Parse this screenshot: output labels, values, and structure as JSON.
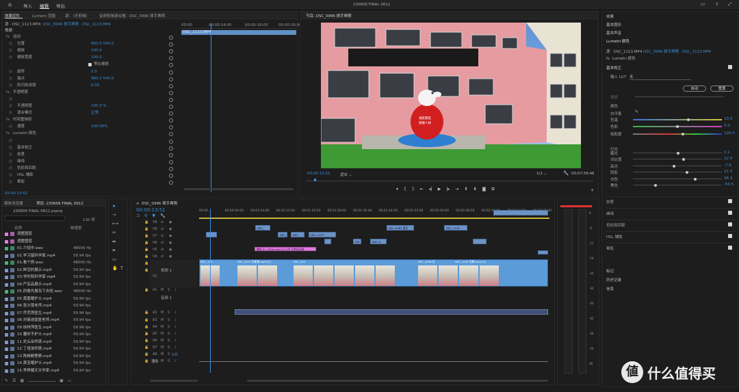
{
  "topbar": {
    "nav": [
      "导入",
      "编辑",
      "导出"
    ],
    "title": "230606 FINAL 0612"
  },
  "source_panel": {
    "tabs": [
      "效果控件",
      "Lumetri 范围",
      "源：（无剪辑）",
      "音频剪辑混合器：DSC_0996 择手典照"
    ],
    "source_label": "源 · DSC_1113.MP4",
    "seq_label": "DSC_0996 择手典照 · DSC_1113.MP4",
    "video_header": "视频",
    "ruler": [
      "00:00",
      "00:00:14:00",
      "00:00:16:00",
      "00:00:18:00"
    ],
    "clip_label": "DSC_1113.MP4",
    "rows": [
      {
        "name": "运动",
        "val": "",
        "indent": 1
      },
      {
        "name": "位置",
        "val": "960.0    540.0",
        "indent": 2
      },
      {
        "name": "缩放",
        "val": "100.0",
        "indent": 2
      },
      {
        "name": "缩放宽度",
        "val": "100.0",
        "indent": 2
      },
      {
        "name": "",
        "val": "等比缩放",
        "indent": 3
      },
      {
        "name": "旋转",
        "val": "0.0",
        "indent": 2
      },
      {
        "name": "锚点",
        "val": "960.0    540.0",
        "indent": 2
      },
      {
        "name": "防闪烁滤镜",
        "val": "0.00",
        "indent": 2
      },
      {
        "name": "不透明度",
        "val": "",
        "indent": 1
      },
      {
        "name": "",
        "val": "",
        "indent": 2
      },
      {
        "name": "不透明度",
        "val": "100.0 %",
        "indent": 2
      },
      {
        "name": "混合模式",
        "val": "正常",
        "indent": 2
      },
      {
        "name": "时间重映射",
        "val": "",
        "indent": 1
      },
      {
        "name": "速度",
        "val": "100.00%",
        "indent": 2
      },
      {
        "name": "Lumetri 颜色",
        "val": "",
        "indent": 1
      },
      {
        "name": "",
        "val": "",
        "indent": 2
      },
      {
        "name": "基本校正",
        "val": "",
        "indent": 2
      },
      {
        "name": "创意",
        "val": "",
        "indent": 2
      },
      {
        "name": "曲线",
        "val": "",
        "indent": 2
      },
      {
        "name": "色轮和匹配",
        "val": "",
        "indent": 2
      },
      {
        "name": "HSL 辅助",
        "val": "",
        "indent": 2
      },
      {
        "name": "晕影",
        "val": "",
        "indent": 2
      }
    ],
    "timecode": "00:00:13:51"
  },
  "program": {
    "tab": "节目: DSC_0996 择手典照",
    "timecode": "00:00:13:51",
    "fit": "适合",
    "quality": "1/2",
    "duration": "00:07:59:46",
    "sign_text": [
      "满庭都是",
      "健康人格"
    ]
  },
  "lumetri": {
    "menu": [
      "效果",
      "基本图形",
      "基本声音",
      "Lumetri 颜色"
    ],
    "source": "源 · DSC_1113.MP4",
    "seq": "DSC_0996 择手典照 · DSC_1113.MP4",
    "fx_label": "Lumetri 颜色",
    "basic": "基本校正",
    "lut_label": "输入 LUT",
    "lut_val": "无",
    "auto": "自动",
    "reset": "重置",
    "intensity": "强度",
    "color_head": "颜色",
    "wb": "白平衡",
    "light_head": "灯光",
    "sliders": [
      {
        "name": "色温",
        "val": "10.0",
        "pos": 0.62
      },
      {
        "name": "色彩",
        "val": "0.0",
        "pos": 0.5
      },
      {
        "name": "饱和度",
        "val": "120.0",
        "pos": 0.56
      },
      {
        "name": "曝光",
        "val": "0.1",
        "pos": 0.51
      },
      {
        "name": "对比度",
        "val": "12.9",
        "pos": 0.57
      },
      {
        "name": "高光",
        "val": "-7.6",
        "pos": 0.46
      },
      {
        "name": "阴影",
        "val": "21.3",
        "pos": 0.61
      },
      {
        "name": "白色",
        "val": "38.3",
        "pos": 0.7
      },
      {
        "name": "黑色",
        "val": "-50.5",
        "pos": 0.25
      }
    ],
    "sections": [
      "创意",
      "曲线",
      "色轮和匹配",
      "HSL 辅助",
      "晕影"
    ],
    "bottom": [
      "标记",
      "历史记录",
      "信息"
    ]
  },
  "project": {
    "tabs": [
      "媒体浏览器",
      "项目: 230606 FINAL 0612"
    ],
    "file": "230606 FINAL 0612.prproj",
    "count": "130 项",
    "col_name": "名称",
    "col_rate": "帧速率",
    "items": [
      {
        "name": "调整图层",
        "rate": "",
        "c": "#e27ce0"
      },
      {
        "name": "调整图层",
        "rate": "",
        "c": "#e27ce0"
      },
      {
        "name": "01.介绍中.wav",
        "rate": "48000 Hz",
        "c": "#48b47e"
      },
      {
        "name": "01.学习猛科学家.mp4",
        "rate": "59.94 fps",
        "c": "#7e96c7"
      },
      {
        "name": "01.看个例.wav",
        "rate": "48000 Hz",
        "c": "#48b47e"
      },
      {
        "name": "02.鲜活的展示.mp4",
        "rate": "59.94 fps",
        "c": "#7e96c7"
      },
      {
        "name": "03.学的阳科学家.mp4",
        "rate": "59.94 fps",
        "c": "#7e96c7"
      },
      {
        "name": "04.严芸品展示.mp4",
        "rate": "59.94 fps",
        "c": "#7e96c7"
      },
      {
        "name": "05.同看先展及下去啦.wav",
        "rate": "48000 Hz",
        "c": "#48b47e"
      },
      {
        "name": "05.黄嘉耀护士.mp4",
        "rate": "59.94 fps",
        "c": "#7e96c7"
      },
      {
        "name": "06.张沙蓬老师.mp4",
        "rate": "59.94 fps",
        "c": "#7e96c7"
      },
      {
        "name": "07.乔范莲医生.mp4",
        "rate": "59.94 fps",
        "c": "#7e96c7"
      },
      {
        "name": "08.刘曼迪兽医老师.mp4",
        "rate": "59.94 fps",
        "c": "#7e96c7"
      },
      {
        "name": "09.徐林萍医生.mp4",
        "rate": "59.94 fps",
        "c": "#7e96c7"
      },
      {
        "name": "10.蕃昕予护士.mp4",
        "rate": "59.94 fps",
        "c": "#7e96c7"
      },
      {
        "name": "11.史云朵师席.mp4",
        "rate": "59.94 fps",
        "c": "#7e96c7"
      },
      {
        "name": "12.丁增淑师席.mp4",
        "rate": "59.94 fps",
        "c": "#7e96c7"
      },
      {
        "name": "13.陈嫣殿警察.mp4",
        "rate": "59.94 fps",
        "c": "#7e96c7"
      },
      {
        "name": "14.黄宝喔护士.mp4",
        "rate": "59.94 fps",
        "c": "#7e96c7"
      },
      {
        "name": "15.李婷婕天文学家.mp4",
        "rate": "59.94 fps",
        "c": "#7e96c7"
      }
    ]
  },
  "timeline": {
    "tab": "DSC_0996 择手典照",
    "timecode": "00:00:13:51",
    "ruler": [
      "00:00",
      "00:00:04:00",
      "00:01:04:00",
      "00:01:12:00",
      "00:01:20:00",
      "00:01:28:00",
      "00:01:36:00",
      "00:01:44:00",
      "00:01:52:00",
      "00:02:00:00",
      "00:02:08:00",
      "00:02:16:00",
      "00:02:24:00",
      "00:02:32:00"
    ],
    "v_tracks": [
      "V9",
      "V8",
      "V7",
      "V6",
      "V5",
      "V4",
      "V3",
      "V2",
      "V1"
    ],
    "a_tracks": [
      "A1",
      "A2",
      "A3",
      "A4",
      "A5",
      "A6",
      "A7",
      "A8",
      "A9"
    ],
    "v1_name": "视频 1",
    "a1_name": "音频 1",
    "mix": "混合",
    "mix_val": "0.0",
    "clips": [
      {
        "t": "DSC_",
        "c": "blue"
      },
      {
        "t": "DSC_0563 音乐",
        "c": "blue"
      },
      {
        "t": "DSC_1116",
        "c": "blue"
      },
      {
        "t": "DSC_2",
        "c": "blue"
      },
      {
        "t": "DSC",
        "c": "blue"
      },
      {
        "t": "DSC_1027",
        "c": "blue"
      },
      {
        "t": "DSC_0",
        "c": "blue"
      },
      {
        "t": "DSC_0",
        "c": "blue"
      },
      {
        "t": "图层 01_0320.mp4 [V] 1月 计划运动选",
        "c": "pink"
      }
    ],
    "v1_labels": [
      "DSC_100",
      "DSC_1027 芳景景.mp4 [V]",
      "DSC_102",
      "DSC_1036 芳",
      "DSC_1034 芳景.mp4 [V]"
    ]
  },
  "meter": {
    "scale": [
      "0",
      "-6",
      "-12",
      "-18",
      "-24",
      "-30",
      "-36",
      "-42",
      "-48",
      "-54",
      "dB"
    ]
  },
  "watermark": "什么值得买"
}
